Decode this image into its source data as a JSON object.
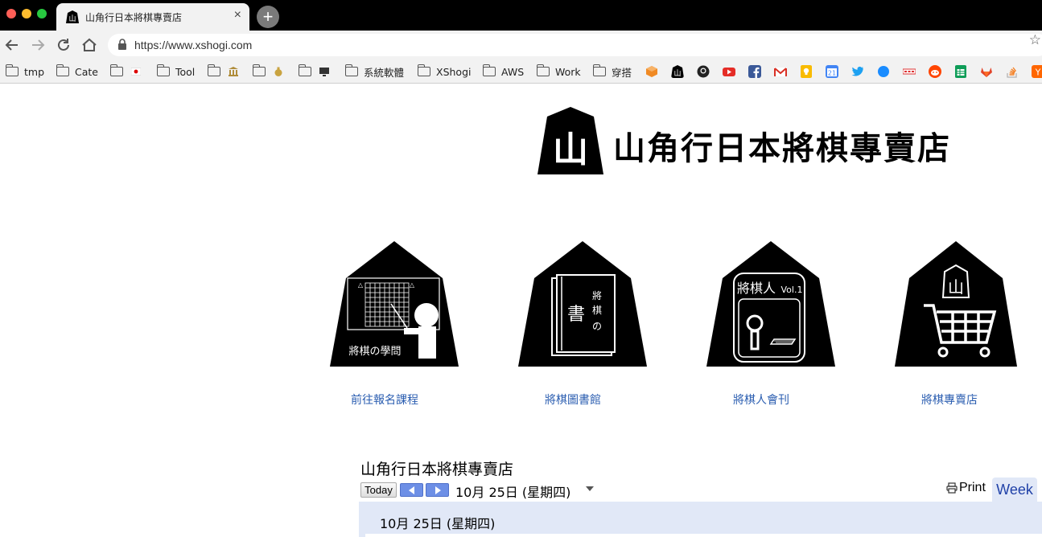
{
  "browser": {
    "tab_title": "山角行日本將棋專賣店",
    "url": "https://www.xshogi.com",
    "bookmarks": [
      {
        "label": "tmp",
        "type": "folder"
      },
      {
        "label": "Cate",
        "type": "folder"
      },
      {
        "label": "",
        "type": "folder",
        "emoji": "🇯🇵"
      },
      {
        "label": "Tool",
        "type": "folder"
      },
      {
        "label": "",
        "type": "folder",
        "emoji": "🏦"
      },
      {
        "label": "",
        "type": "folder",
        "emoji": "💰"
      },
      {
        "label": "",
        "type": "folder",
        "emoji": "🖥"
      },
      {
        "label": "系統軟體",
        "type": "folder"
      },
      {
        "label": "XShogi",
        "type": "folder"
      },
      {
        "label": "AWS",
        "type": "folder"
      },
      {
        "label": "Work",
        "type": "folder"
      },
      {
        "label": "穿搭",
        "type": "folder"
      }
    ],
    "favicon_bookmarks": [
      "aws-cube-icon",
      "shogi-icon",
      "github-icon",
      "youtube-icon",
      "facebook-icon",
      "gmail-icon",
      "keep-icon",
      "calendar-icon",
      "twitter-icon",
      "blue-dot-icon",
      "slides-icon",
      "reddit-icon",
      "sheets-icon",
      "gitlab-icon",
      "stackoverflow-icon",
      "ycombinator-icon"
    ],
    "calendar_icon_day": "21",
    "ycombinator_letter": "Y"
  },
  "site": {
    "logo_text": "山角行日本將棋專賣店",
    "logo_piece_char": "山",
    "pieces": [
      {
        "link": "前往報名課程",
        "caption": "將棋の學問"
      },
      {
        "link": "將棋圖書館",
        "book_char": "書",
        "book_side": "將棋の"
      },
      {
        "link": "將棋人會刊",
        "header": "將棋人",
        "vol": "Vol.1"
      },
      {
        "link": "將棋專賣店",
        "char": "山"
      }
    ]
  },
  "calendar": {
    "title": "山角行日本將棋專賣店",
    "today_label": "Today",
    "date_label": "10月 25日 (星期四)",
    "print_label": "Print",
    "week_label": "Week",
    "day_header": "10月 25日 (星期四)"
  },
  "colors": {
    "link": "#2a5db0",
    "calendar_accent": "#e1e8f7",
    "nav_button": "#6d8fe6"
  }
}
